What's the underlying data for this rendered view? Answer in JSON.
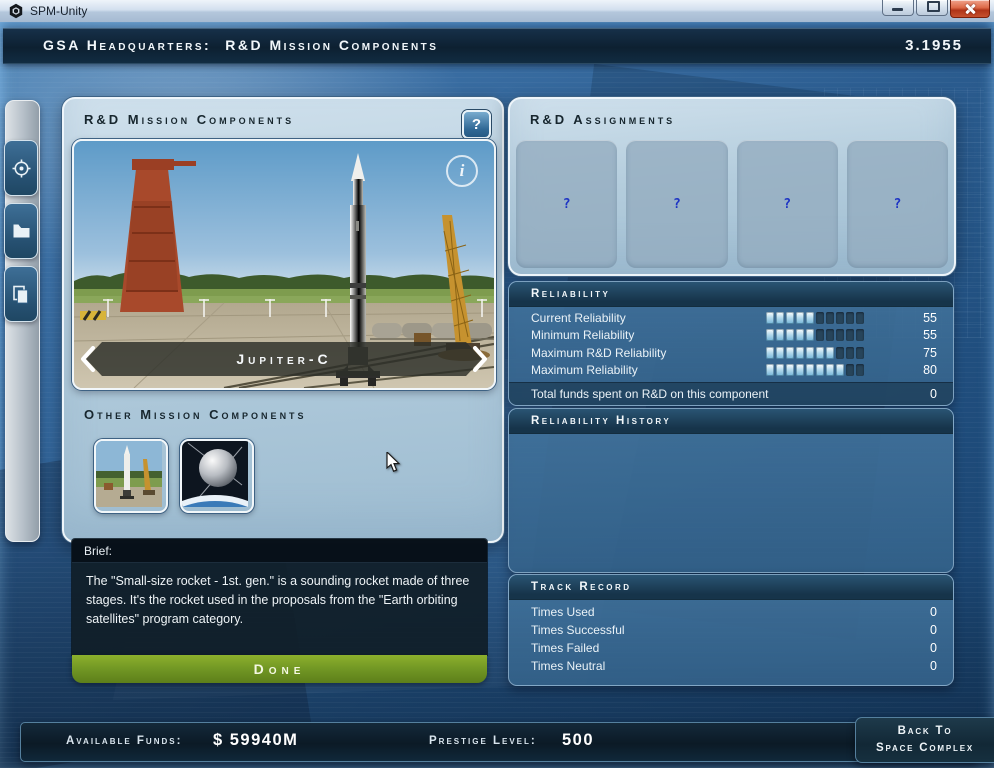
{
  "window": {
    "title": "SPM-Unity"
  },
  "header": {
    "location": "GSA Headquarters:",
    "screen": "R&D Mission Components",
    "date": "3.1955"
  },
  "components_panel": {
    "title": "R&D Mission Components",
    "help_glyph": "?",
    "carousel": {
      "selected_name": "Jupiter-C",
      "info_glyph": "i"
    },
    "other_title": "Other Mission Components"
  },
  "brief": {
    "label": "Brief:",
    "text": "The \"Small-size rocket - 1st. gen.\" is a sounding rocket made of three stages. It's the rocket used in the proposals from the \"Earth orbiting satellites\" program category."
  },
  "done_button": "Done",
  "assignments": {
    "title": "R&D Assignments",
    "slots": [
      {
        "glyph": "?"
      },
      {
        "glyph": "?"
      },
      {
        "glyph": "?"
      },
      {
        "glyph": "?"
      }
    ]
  },
  "reliability": {
    "title": "Reliability",
    "segments_total": 10,
    "rows": [
      {
        "label": "Current Reliability",
        "value": "55",
        "segments": 5
      },
      {
        "label": "Minimum Reliability",
        "value": "55",
        "segments": 5
      },
      {
        "label": "Maximum R&D Reliability",
        "value": "75",
        "segments": 7
      },
      {
        "label": "Maximum Reliability",
        "value": "80",
        "segments": 8
      }
    ],
    "total_label": "Total funds spent on R&D on this component",
    "total_value": "0"
  },
  "history": {
    "title": "Reliability History"
  },
  "track_record": {
    "title": "Track Record",
    "rows": [
      {
        "label": "Times Used",
        "value": "0"
      },
      {
        "label": "Times Successful",
        "value": "0"
      },
      {
        "label": "Times Failed",
        "value": "0"
      },
      {
        "label": "Times Neutral",
        "value": "0"
      }
    ]
  },
  "footer": {
    "funds_label": "Available Funds:",
    "funds_value": "$ 59940M",
    "prestige_label": "Prestige Level:",
    "prestige_value": "500",
    "back_line1": "Back To",
    "back_line2": "Space Complex"
  },
  "colors": {
    "accent_blue": "#3f76a8",
    "panel_light": "#b9cfdf",
    "panel_deep": "#3f6d97",
    "header_dark": "#16344a",
    "done_green": "#6f9423",
    "close_red": "#c03a1c",
    "slot_question_blue": "#1d33c4"
  }
}
